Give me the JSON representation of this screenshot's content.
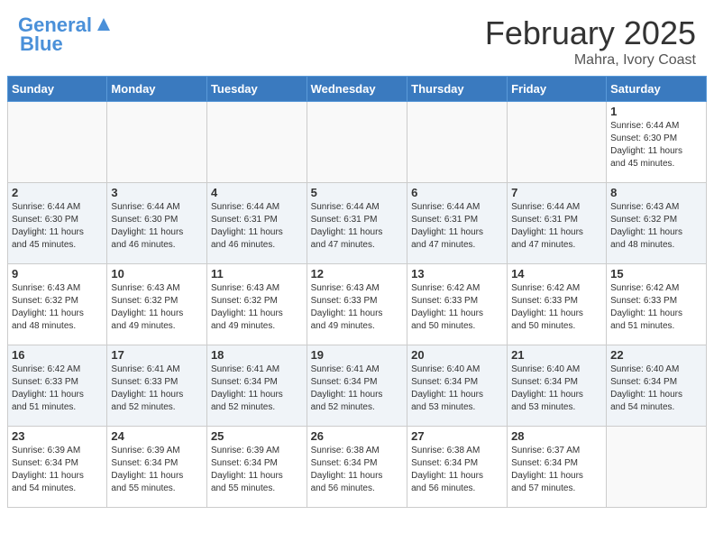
{
  "header": {
    "logo_line1": "General",
    "logo_line2": "Blue",
    "month_title": "February 2025",
    "location": "Mahra, Ivory Coast"
  },
  "weekdays": [
    "Sunday",
    "Monday",
    "Tuesday",
    "Wednesday",
    "Thursday",
    "Friday",
    "Saturday"
  ],
  "weeks": [
    [
      {
        "day": "",
        "info": ""
      },
      {
        "day": "",
        "info": ""
      },
      {
        "day": "",
        "info": ""
      },
      {
        "day": "",
        "info": ""
      },
      {
        "day": "",
        "info": ""
      },
      {
        "day": "",
        "info": ""
      },
      {
        "day": "1",
        "info": "Sunrise: 6:44 AM\nSunset: 6:30 PM\nDaylight: 11 hours\nand 45 minutes."
      }
    ],
    [
      {
        "day": "2",
        "info": "Sunrise: 6:44 AM\nSunset: 6:30 PM\nDaylight: 11 hours\nand 45 minutes."
      },
      {
        "day": "3",
        "info": "Sunrise: 6:44 AM\nSunset: 6:30 PM\nDaylight: 11 hours\nand 46 minutes."
      },
      {
        "day": "4",
        "info": "Sunrise: 6:44 AM\nSunset: 6:31 PM\nDaylight: 11 hours\nand 46 minutes."
      },
      {
        "day": "5",
        "info": "Sunrise: 6:44 AM\nSunset: 6:31 PM\nDaylight: 11 hours\nand 47 minutes."
      },
      {
        "day": "6",
        "info": "Sunrise: 6:44 AM\nSunset: 6:31 PM\nDaylight: 11 hours\nand 47 minutes."
      },
      {
        "day": "7",
        "info": "Sunrise: 6:44 AM\nSunset: 6:31 PM\nDaylight: 11 hours\nand 47 minutes."
      },
      {
        "day": "8",
        "info": "Sunrise: 6:43 AM\nSunset: 6:32 PM\nDaylight: 11 hours\nand 48 minutes."
      }
    ],
    [
      {
        "day": "9",
        "info": "Sunrise: 6:43 AM\nSunset: 6:32 PM\nDaylight: 11 hours\nand 48 minutes."
      },
      {
        "day": "10",
        "info": "Sunrise: 6:43 AM\nSunset: 6:32 PM\nDaylight: 11 hours\nand 49 minutes."
      },
      {
        "day": "11",
        "info": "Sunrise: 6:43 AM\nSunset: 6:32 PM\nDaylight: 11 hours\nand 49 minutes."
      },
      {
        "day": "12",
        "info": "Sunrise: 6:43 AM\nSunset: 6:33 PM\nDaylight: 11 hours\nand 49 minutes."
      },
      {
        "day": "13",
        "info": "Sunrise: 6:42 AM\nSunset: 6:33 PM\nDaylight: 11 hours\nand 50 minutes."
      },
      {
        "day": "14",
        "info": "Sunrise: 6:42 AM\nSunset: 6:33 PM\nDaylight: 11 hours\nand 50 minutes."
      },
      {
        "day": "15",
        "info": "Sunrise: 6:42 AM\nSunset: 6:33 PM\nDaylight: 11 hours\nand 51 minutes."
      }
    ],
    [
      {
        "day": "16",
        "info": "Sunrise: 6:42 AM\nSunset: 6:33 PM\nDaylight: 11 hours\nand 51 minutes."
      },
      {
        "day": "17",
        "info": "Sunrise: 6:41 AM\nSunset: 6:33 PM\nDaylight: 11 hours\nand 52 minutes."
      },
      {
        "day": "18",
        "info": "Sunrise: 6:41 AM\nSunset: 6:34 PM\nDaylight: 11 hours\nand 52 minutes."
      },
      {
        "day": "19",
        "info": "Sunrise: 6:41 AM\nSunset: 6:34 PM\nDaylight: 11 hours\nand 52 minutes."
      },
      {
        "day": "20",
        "info": "Sunrise: 6:40 AM\nSunset: 6:34 PM\nDaylight: 11 hours\nand 53 minutes."
      },
      {
        "day": "21",
        "info": "Sunrise: 6:40 AM\nSunset: 6:34 PM\nDaylight: 11 hours\nand 53 minutes."
      },
      {
        "day": "22",
        "info": "Sunrise: 6:40 AM\nSunset: 6:34 PM\nDaylight: 11 hours\nand 54 minutes."
      }
    ],
    [
      {
        "day": "23",
        "info": "Sunrise: 6:39 AM\nSunset: 6:34 PM\nDaylight: 11 hours\nand 54 minutes."
      },
      {
        "day": "24",
        "info": "Sunrise: 6:39 AM\nSunset: 6:34 PM\nDaylight: 11 hours\nand 55 minutes."
      },
      {
        "day": "25",
        "info": "Sunrise: 6:39 AM\nSunset: 6:34 PM\nDaylight: 11 hours\nand 55 minutes."
      },
      {
        "day": "26",
        "info": "Sunrise: 6:38 AM\nSunset: 6:34 PM\nDaylight: 11 hours\nand 56 minutes."
      },
      {
        "day": "27",
        "info": "Sunrise: 6:38 AM\nSunset: 6:34 PM\nDaylight: 11 hours\nand 56 minutes."
      },
      {
        "day": "28",
        "info": "Sunrise: 6:37 AM\nSunset: 6:34 PM\nDaylight: 11 hours\nand 57 minutes."
      },
      {
        "day": "",
        "info": ""
      }
    ]
  ]
}
